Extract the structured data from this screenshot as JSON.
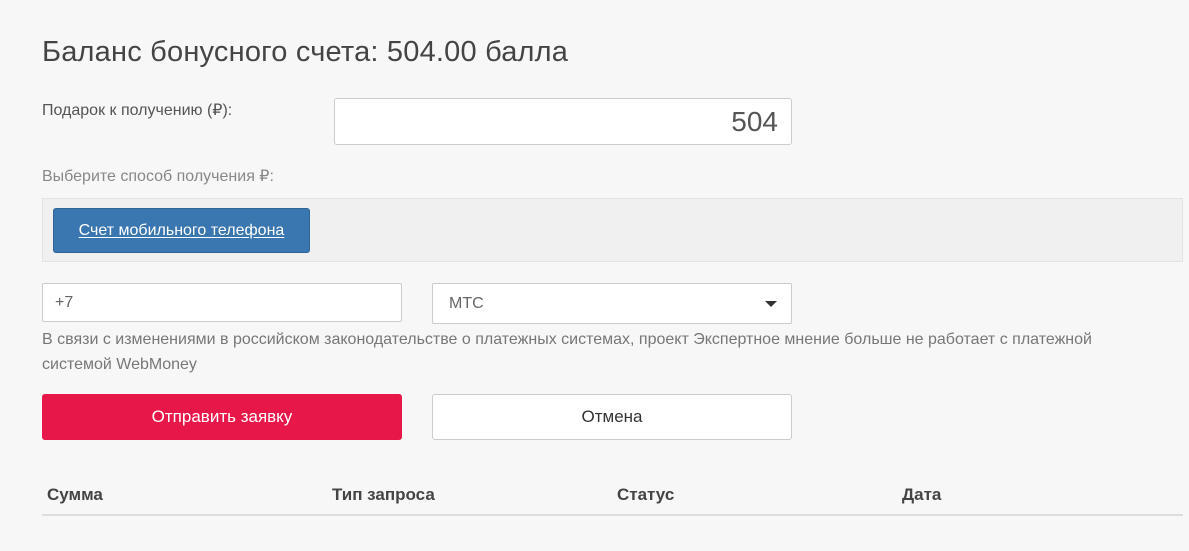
{
  "balance": {
    "title": "Баланс бонусного счета: 504.00 балла"
  },
  "gift": {
    "label": "Подарок к получению (₽):",
    "value": "504"
  },
  "method": {
    "label": "Выберите способ получения ₽:",
    "button_label": "Счет мобильного телефона"
  },
  "phone": {
    "value": "+7"
  },
  "operator": {
    "selected": "МТС"
  },
  "notice": {
    "text": "В связи с изменениями в российском законодательстве о платежных системах, проект Экспертное мнение больше не работает с платежной системой WebMoney"
  },
  "actions": {
    "submit_label": "Отправить заявку",
    "cancel_label": "Отмена"
  },
  "table": {
    "columns": [
      "Сумма",
      "Тип запроса",
      "Статус",
      "Дата"
    ]
  },
  "colors": {
    "submit": "#e8174a",
    "method_button": "#3a76b0",
    "background": "#f7f7f7"
  }
}
